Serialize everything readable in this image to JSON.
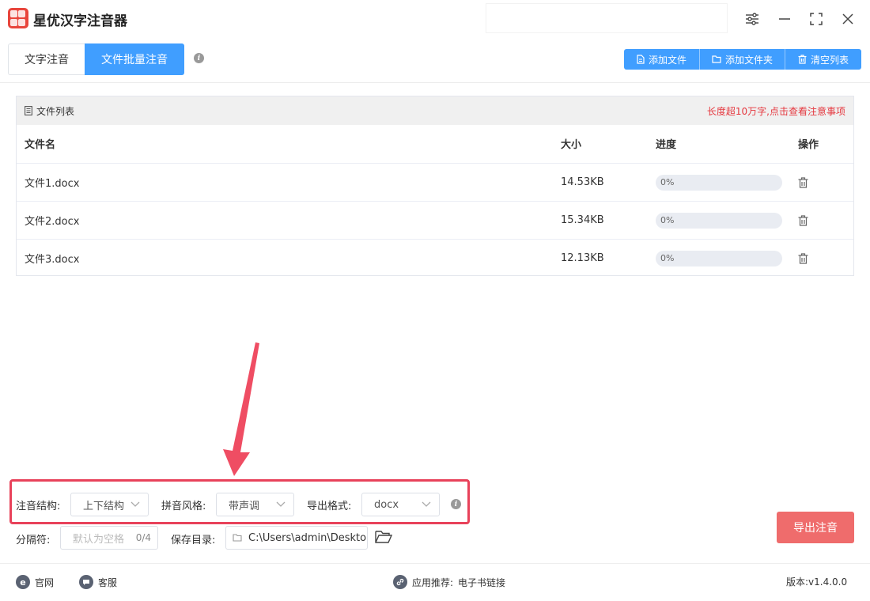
{
  "app": {
    "title": "星优汉字注音器"
  },
  "tabs": [
    {
      "label": "文字注音",
      "active": false
    },
    {
      "label": "文件批量注音",
      "active": true
    }
  ],
  "actions": {
    "add_file": "添加文件",
    "add_folder": "添加文件夹",
    "clear_list": "清空列表"
  },
  "file_panel": {
    "title": "文件列表",
    "note": "长度超10万字,点击查看注意事项",
    "columns": {
      "name": "文件名",
      "size": "大小",
      "progress": "进度",
      "operation": "操作"
    },
    "files": [
      {
        "name": "文件1.docx",
        "size": "14.53KB",
        "progress_text": "0%",
        "progress": 0
      },
      {
        "name": "文件2.docx",
        "size": "15.34KB",
        "progress_text": "0%",
        "progress": 0
      },
      {
        "name": "文件3.docx",
        "size": "12.13KB",
        "progress_text": "0%",
        "progress": 0
      }
    ]
  },
  "settings": {
    "structure_label": "注音结构:",
    "structure_value": "上下结构",
    "pinyin_label": "拼音风格:",
    "pinyin_value": "带声调",
    "format_label": "导出格式:",
    "format_value": "docx",
    "separator_label": "分隔符:",
    "separator_placeholder": "默认为空格",
    "separator_counter": "0/4",
    "save_label": "保存目录:",
    "save_path": "C:\\Users\\admin\\Deskto"
  },
  "export_button": "导出注音",
  "footer": {
    "website": "官网",
    "service": "客服",
    "recommend_label": "应用推荐:",
    "recommend_link": "电子书链接",
    "version": "版本:v1.4.0.0"
  },
  "colors": {
    "primary": "#409eff",
    "danger": "#ef6c6c",
    "annotation": "#e8425a",
    "logo": "#e8453c"
  }
}
